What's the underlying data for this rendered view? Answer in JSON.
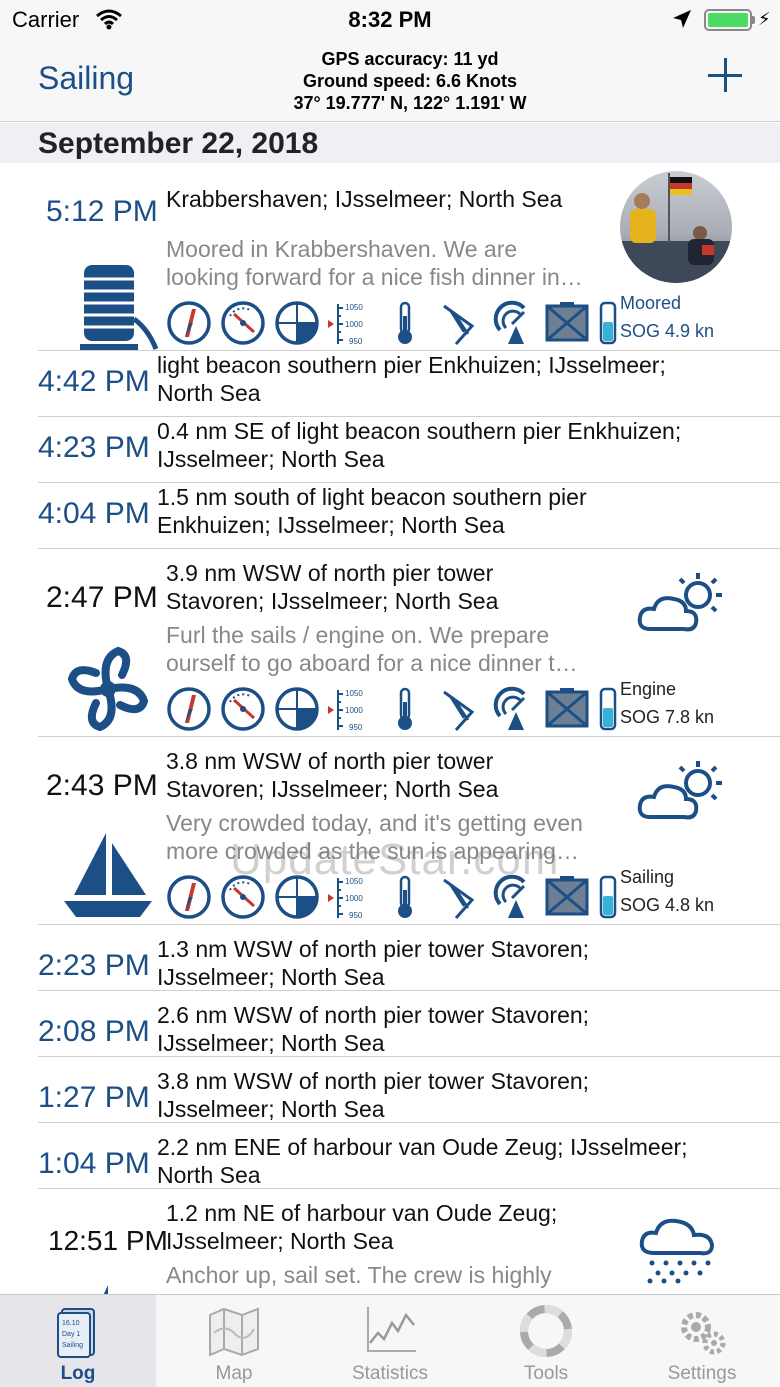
{
  "status_bar": {
    "carrier": "Carrier",
    "time": "8:32 PM"
  },
  "nav": {
    "title": "Sailing",
    "gps_accuracy": "GPS accuracy: 11 yd",
    "ground_speed": "Ground speed: 6.6 Knots",
    "coordinates": "37° 19.777' N, 122° 1.191' W",
    "add_icon": "plus-icon"
  },
  "section": {
    "date": "September 22, 2018"
  },
  "entries": [
    {
      "time": "5:12 PM",
      "location": "Krabbershaven; IJsselmeer; North Sea",
      "note": "Moored in Krabbershaven. We are",
      "note2": "looking forward for a nice fish dinner in…",
      "status": "Moored",
      "sog": "SOG 4.9 kn",
      "icon": "mooring-rope-icon"
    },
    {
      "time": "4:42 PM",
      "location": "light beacon southern pier Enkhuizen; IJsselmeer;",
      "location2": "North Sea"
    },
    {
      "time": "4:23 PM",
      "location": "0.4 nm SE of light beacon southern pier Enkhuizen;",
      "location2": "IJsselmeer; North Sea"
    },
    {
      "time": "4:04 PM",
      "location": "1.5 nm south of light beacon southern pier",
      "location2": "Enkhuizen; IJsselmeer; North Sea"
    },
    {
      "time": "2:47 PM",
      "location": "3.9 nm WSW of north pier tower",
      "location2": "Stavoren; IJsselmeer; North Sea",
      "note": "Furl the sails / engine on. We prepare",
      "note2": "ourself to go aboard for a nice dinner t…",
      "status": "Engine",
      "sog": "SOG 7.8 kn",
      "icon": "propeller-icon"
    },
    {
      "time": "2:43 PM",
      "location": "3.8 nm WSW of north pier tower",
      "location2": "Stavoren; IJsselmeer; North Sea",
      "note": "Very crowded today, and it's getting even",
      "note2": "more crowded as the sun is appearing…",
      "status": "Sailing",
      "sog": "SOG 4.8 kn",
      "icon": "sailboat-icon"
    },
    {
      "time": "2:23 PM",
      "location": "1.3 nm WSW of north pier tower Stavoren;",
      "location2": "IJsselmeer; North Sea"
    },
    {
      "time": "2:08 PM",
      "location": "2.6 nm WSW of north pier tower Stavoren;",
      "location2": "IJsselmeer; North Sea"
    },
    {
      "time": "1:27 PM",
      "location": "3.8 nm WSW of north pier tower Stavoren;",
      "location2": "IJsselmeer; North Sea"
    },
    {
      "time": "1:04 PM",
      "location": "2.2 nm ENE of harbour van Oude Zeug; IJsselmeer;",
      "location2": "North Sea"
    },
    {
      "time": "12:51 PM",
      "location": "1.2 nm NE of harbour van Oude Zeug;",
      "location2": "IJsselmeer; North Sea",
      "note": "Anchor up, sail set. The crew is highly"
    }
  ],
  "barometer": {
    "high": "1050",
    "mid": "1000",
    "low": "950"
  },
  "watermark": "UpdateStar.com",
  "tabs": [
    {
      "label": "Log",
      "icon": "logbook-icon",
      "active": true,
      "icon_text1": "16.10",
      "icon_text2": "Day 1",
      "icon_text3": "Sailing"
    },
    {
      "label": "Map",
      "icon": "map-icon"
    },
    {
      "label": "Statistics",
      "icon": "statistics-icon"
    },
    {
      "label": "Tools",
      "icon": "lifebuoy-icon"
    },
    {
      "label": "Settings",
      "icon": "gears-icon"
    }
  ],
  "colors": {
    "accent": "#1c4f86",
    "note_grey": "#888888",
    "battery": "#4cd964"
  }
}
